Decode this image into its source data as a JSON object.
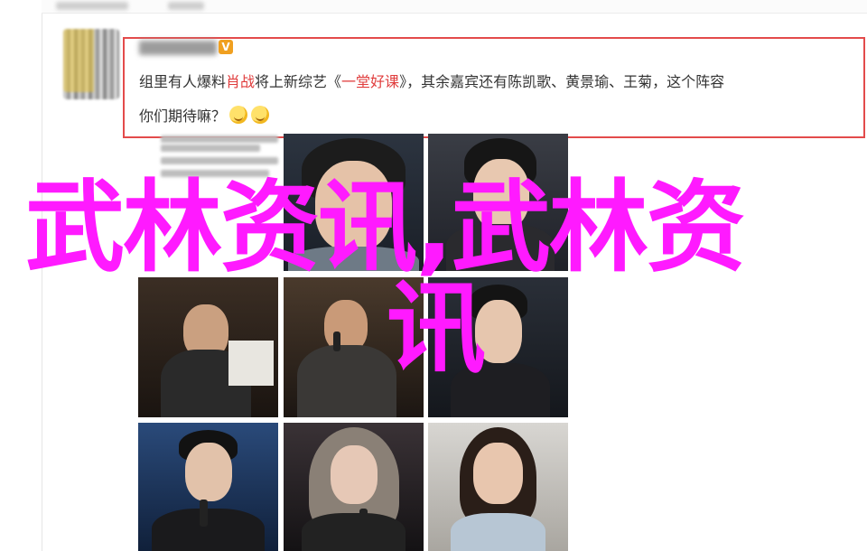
{
  "post": {
    "verified_badge": "V",
    "line1_part1": "组里有人爆料",
    "line1_highlight1": "肖战",
    "line1_part2": "将上新综艺《",
    "line1_highlight2": "一堂好课",
    "line1_part3": "》，其余嘉宾还有陈凯歌、黄景瑜、王菊，这个阵容",
    "line2_text": "你们期待嘛？",
    "emoji_icons": [
      "grin-emoji-icon",
      "grin-emoji-icon"
    ]
  },
  "overlay": {
    "title_line1": "武林资讯,武林资",
    "title_line2": "讯"
  },
  "colors": {
    "overlay": "#ff1aff",
    "highlight": "#e03d3d",
    "border": "#e34b4b"
  }
}
